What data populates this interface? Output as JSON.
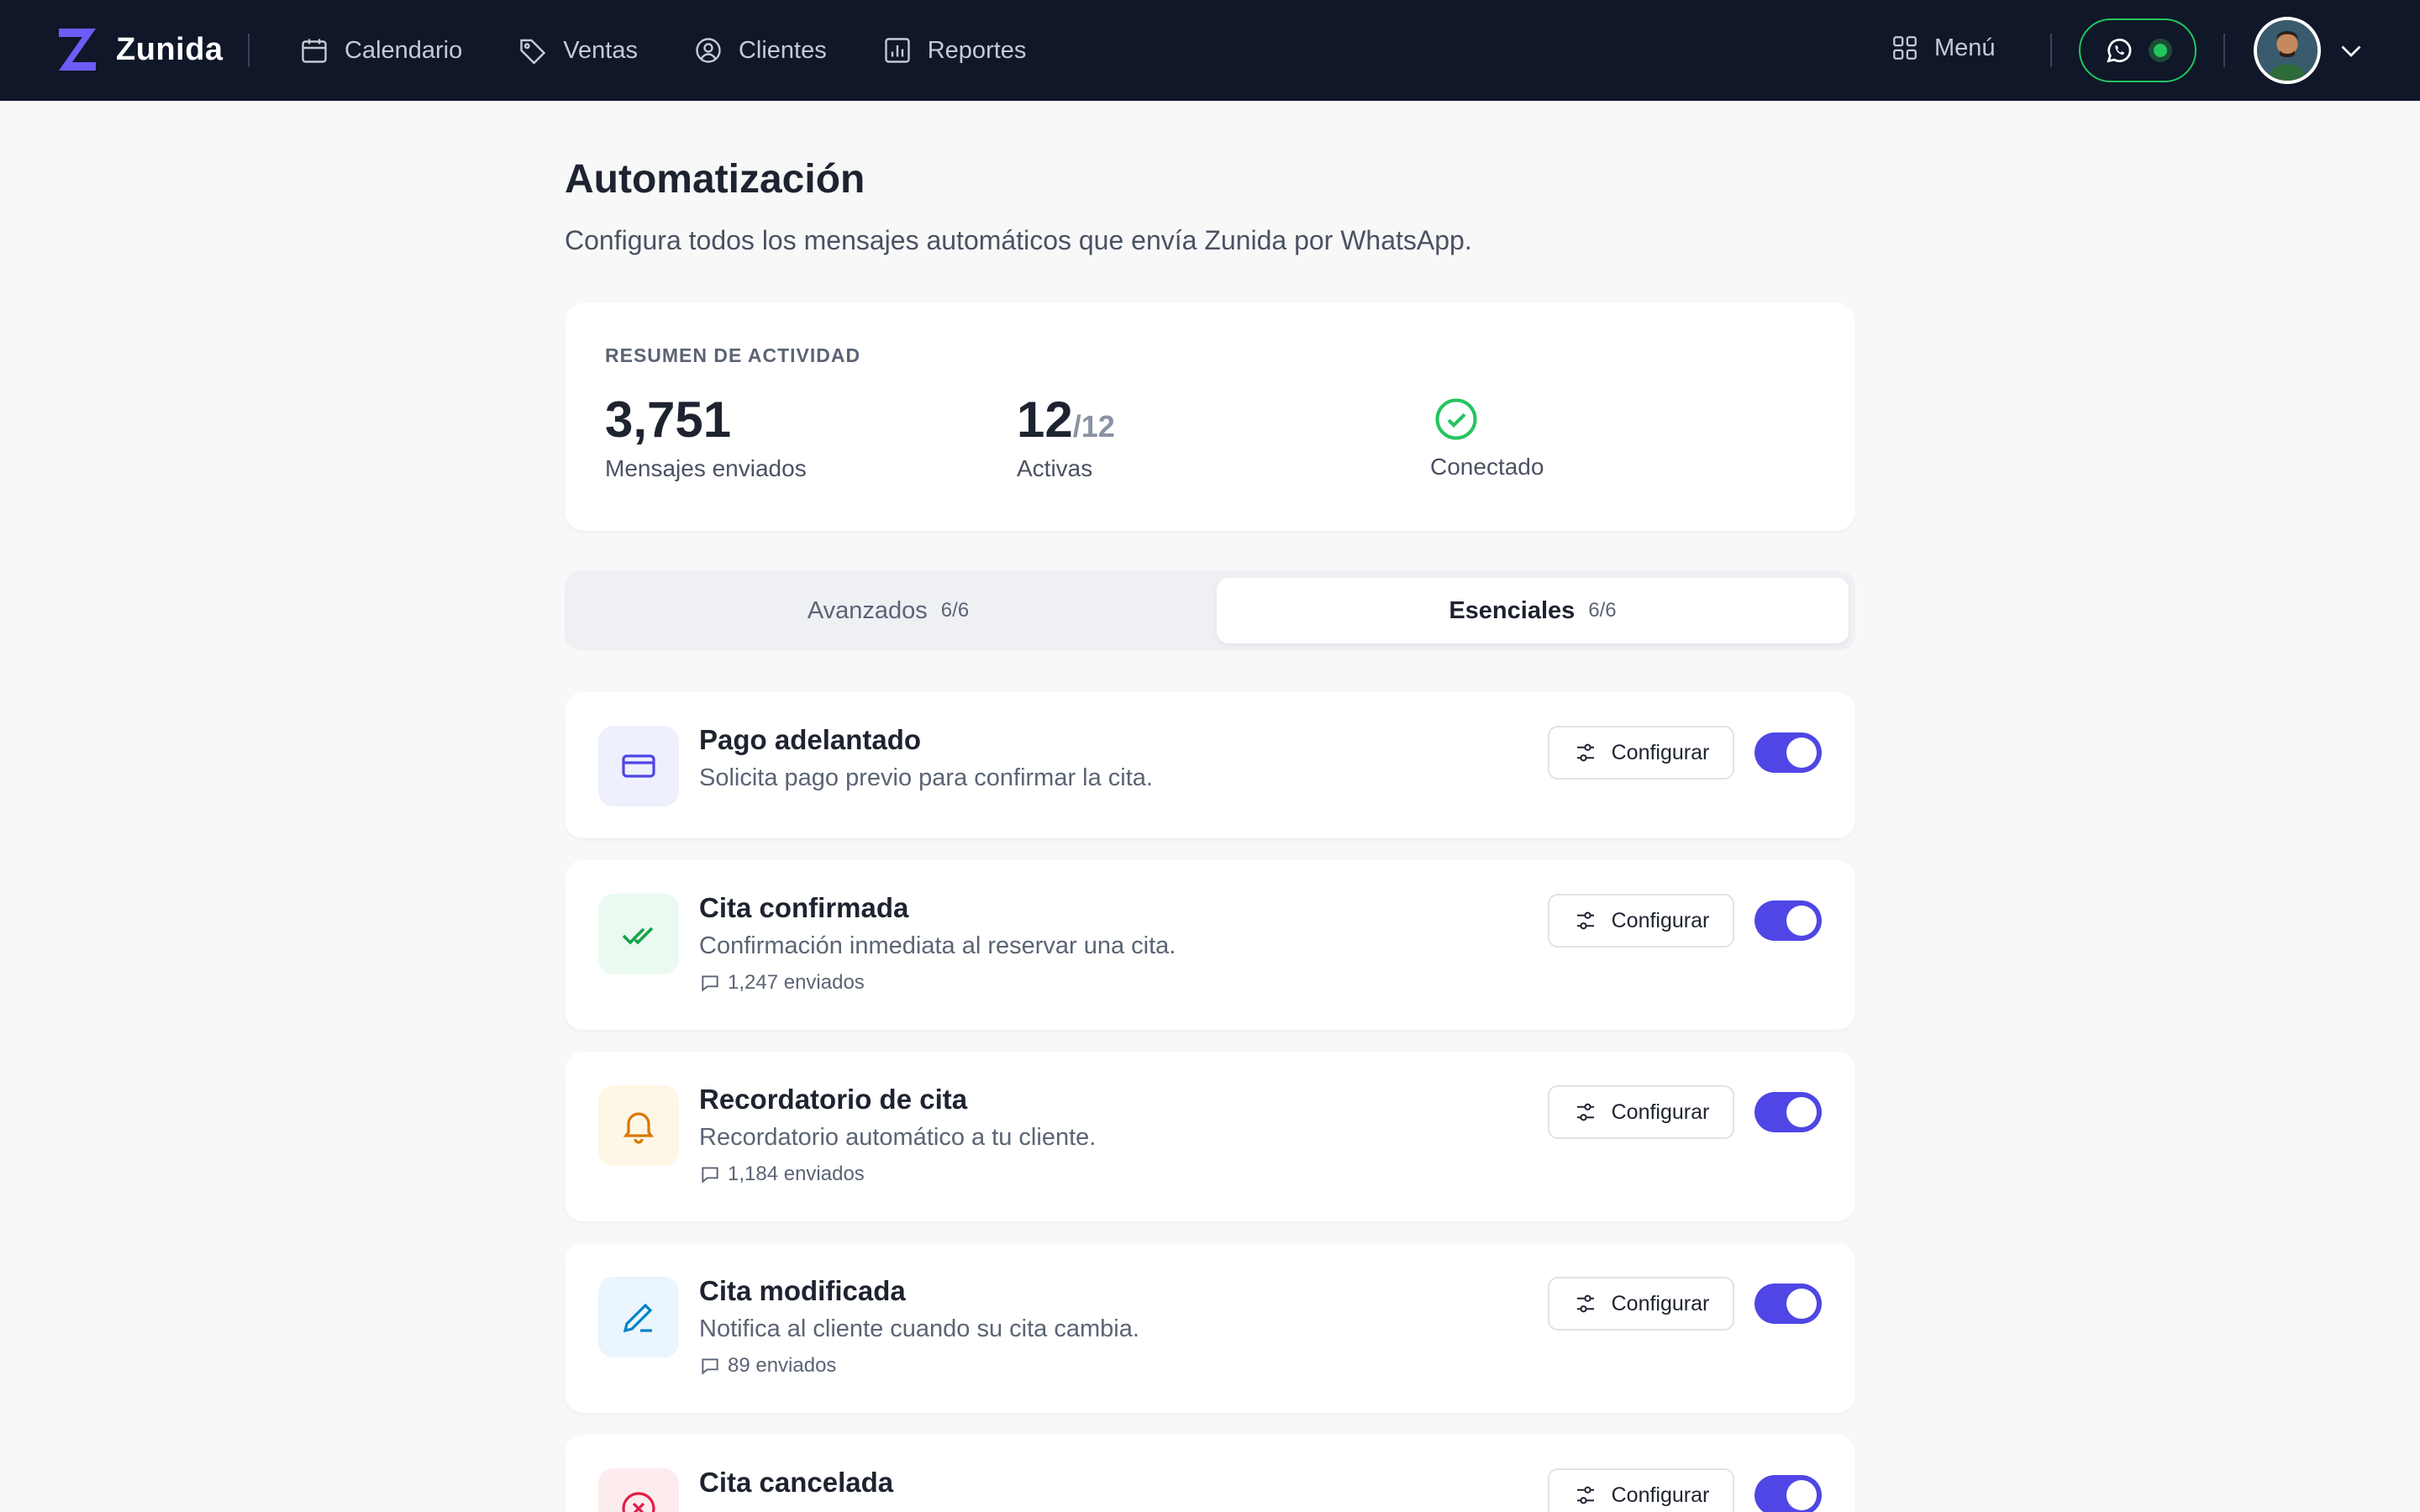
{
  "app": {
    "name": "Zunida",
    "brand_color": "#4f46e5",
    "nav_bg": "#0f1729"
  },
  "nav": {
    "items": [
      {
        "label": "Calendario",
        "icon": "calendar-icon"
      },
      {
        "label": "Ventas",
        "icon": "tag-icon"
      },
      {
        "label": "Clientes",
        "icon": "user-circle-icon"
      },
      {
        "label": "Reportes",
        "icon": "bar-chart-icon"
      }
    ],
    "menu_label": "Menú",
    "whatsapp_status_color": "#22c55e"
  },
  "page": {
    "title": "Automatización",
    "subtitle": "Configura todos los mensajes automáticos que envía Zunida por WhatsApp."
  },
  "summary": {
    "label": "RESUMEN DE ACTIVIDAD",
    "messages_value": "3,751",
    "messages_label": "Mensajes enviados",
    "active_value": "12",
    "active_total": "/12",
    "active_label": "Activas",
    "status_label": "Conectado",
    "status_color": "#22c55e"
  },
  "tabs": [
    {
      "label": "Avanzados",
      "count": "6/6",
      "selected": false
    },
    {
      "label": "Esenciales",
      "count": "6/6",
      "selected": true
    }
  ],
  "configure_label": "Configurar",
  "automations": [
    {
      "title": "Pago adelantado",
      "description": "Solicita pago previo para confirmar la cita.",
      "sent": "",
      "icon": "credit-card-icon",
      "icon_bg": "#eef0fd",
      "icon_color": "#4f46e5",
      "enabled": true
    },
    {
      "title": "Cita confirmada",
      "description": "Confirmación inmediata al reservar una cita.",
      "sent": "1,247 enviados",
      "icon": "double-check-icon",
      "icon_bg": "#eafaf1",
      "icon_color": "#16a34a",
      "enabled": true
    },
    {
      "title": "Recordatorio de cita",
      "description": "Recordatorio automático a tu cliente.",
      "sent": "1,184 enviados",
      "icon": "bell-icon",
      "icon_bg": "#fef7e6",
      "icon_color": "#d97706",
      "enabled": true
    },
    {
      "title": "Cita modificada",
      "description": "Notifica al cliente cuando su cita cambia.",
      "sent": "89 enviados",
      "icon": "pencil-icon",
      "icon_bg": "#eaf5fd",
      "icon_color": "#0284c7",
      "enabled": true
    },
    {
      "title": "Cita cancelada",
      "description": "",
      "sent": "",
      "icon": "x-circle-icon",
      "icon_bg": "#fdecee",
      "icon_color": "#e11d48",
      "enabled": true
    }
  ]
}
